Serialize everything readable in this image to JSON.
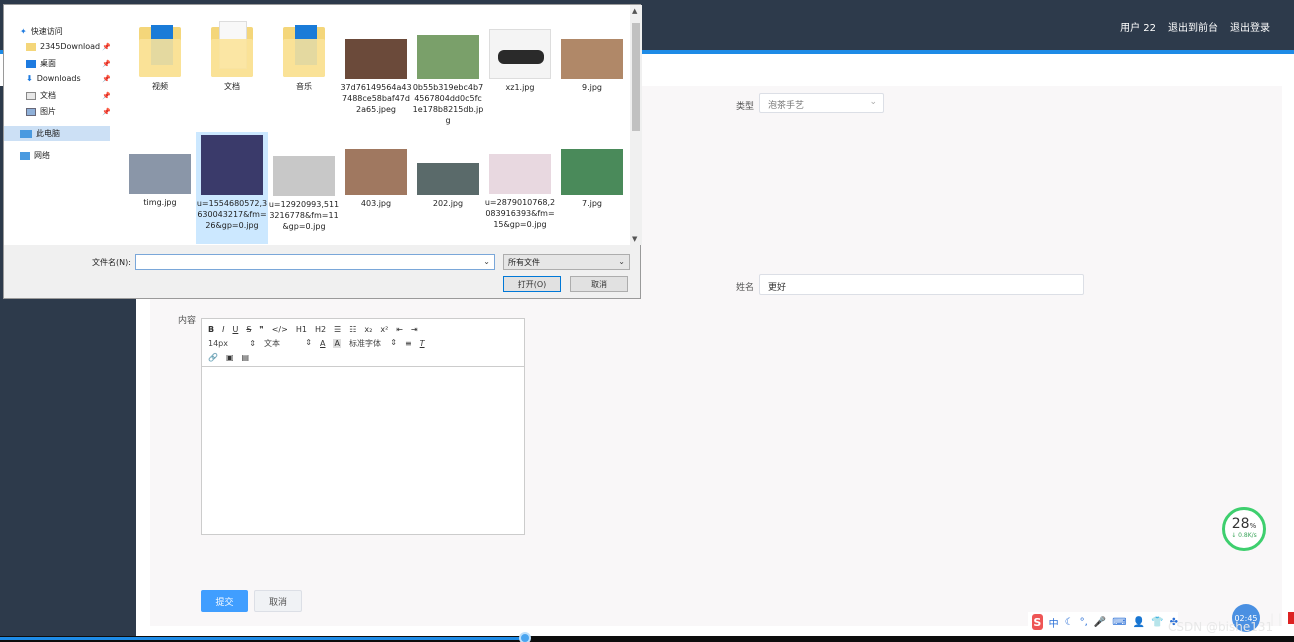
{
  "header": {
    "user_label": "用户 22",
    "exit_front": "退出到前台",
    "logout": "退出登录"
  },
  "form": {
    "type_label": "类型",
    "type_value": "泡茶手艺",
    "name_label": "姓名",
    "name_value": "更好",
    "content_label": "内容",
    "submit": "提交",
    "cancel": "取消"
  },
  "editor": {
    "row1": [
      "B",
      "I",
      "U",
      "S",
      "❞",
      "</>",
      "H1",
      "H2",
      "☰",
      "☷",
      "x₂",
      "x²",
      "⇤",
      "⇥"
    ],
    "font_size": "14px",
    "text_style": "文本",
    "font_family": "标准字体",
    "row3_icons": [
      "link-icon",
      "image-icon",
      "video-icon"
    ]
  },
  "dialog": {
    "nav": [
      {
        "label": "快速访问",
        "icon": "star-icon"
      },
      {
        "label": "2345Download",
        "icon": "folder-icon",
        "pinned": true
      },
      {
        "label": "桌面",
        "icon": "desktop-icon",
        "pinned": true
      },
      {
        "label": "Downloads",
        "icon": "download-icon",
        "pinned": true
      },
      {
        "label": "文档",
        "icon": "document-icon",
        "pinned": true
      },
      {
        "label": "图片",
        "icon": "picture-icon",
        "pinned": true
      },
      {
        "label": "此电脑",
        "icon": "computer-icon"
      },
      {
        "label": "网络",
        "icon": "network-icon"
      }
    ],
    "files": [
      {
        "name": "视频",
        "kind": "folder"
      },
      {
        "name": "文档",
        "kind": "folder"
      },
      {
        "name": "音乐",
        "kind": "folder"
      },
      {
        "name": "37d76149564a437488ce58baf47d2a65.jpeg",
        "kind": "image",
        "color": "#6b4a3a"
      },
      {
        "name": "0b55b319ebc4b74567804dd0c5fc1e178b8215db.jpg",
        "kind": "image",
        "color": "#7aa06a"
      },
      {
        "name": "xz1.jpg",
        "kind": "image",
        "color": "#2a2a2a"
      },
      {
        "name": "9.jpg",
        "kind": "image",
        "color": "#b08868"
      },
      {
        "name": "timg.jpg",
        "kind": "image",
        "color": "#8a96a8"
      },
      {
        "name": "u=1554680572,3630043217&fm=26&gp=0.jpg",
        "kind": "image",
        "color": "#3a3a6a"
      },
      {
        "name": "u=12920993,5113216778&fm=11&gp=0.jpg",
        "kind": "image",
        "color": "#c8c8c8"
      },
      {
        "name": "403.jpg",
        "kind": "image",
        "color": "#a07860"
      },
      {
        "name": "202.jpg",
        "kind": "image",
        "color": "#5a6a6a"
      },
      {
        "name": "u=2879010768,2083916393&fm=15&gp=0.jpg",
        "kind": "image",
        "color": "#e8d8e0"
      },
      {
        "name": "7.jpg",
        "kind": "image",
        "color": "#4a8a5a"
      }
    ],
    "filename_label": "文件名(N):",
    "filename_value": "",
    "filetype": "所有文件",
    "open_button": "打开(O)",
    "cancel_button": "取消"
  },
  "overlay": {
    "speed_percent": "28",
    "speed_unit": "%",
    "speed_rate": "↓ 0.8K/s",
    "ime_chinese": "中",
    "clock": "02:45",
    "watermark": "CSDN @bishe131"
  },
  "colors": {
    "accent": "#1e8be6",
    "primary_button": "#409eff",
    "header_bg": "#2d3a4b"
  }
}
